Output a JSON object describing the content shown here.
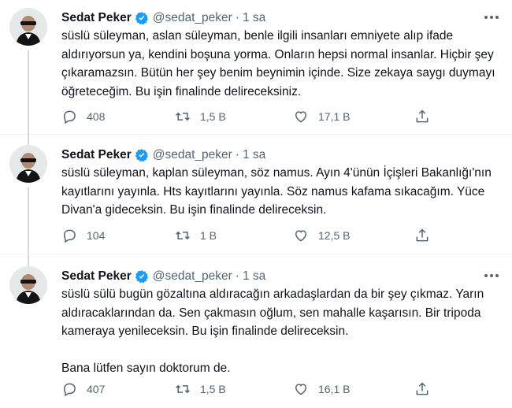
{
  "tweets": [
    {
      "name": "Sedat Peker",
      "handle": "@sedat_peker",
      "separator": "·",
      "time": "1 sa",
      "paragraphs": [
        "süslü süleyman, aslan süleyman, benle ilgili insanları emniyete alıp ifade aldırıyorsun ya, kendini boşuna yorma. Onların hepsi normal insanlar. Hiçbir şey çıkaramazsın. Bütün her şey benim beynimin içinde. Size zekaya saygı duymayı öğreteceğim. Bu işin finalinde delireceksiniz."
      ],
      "replies": "408",
      "retweets": "1,5 B",
      "likes": "17,1 B"
    },
    {
      "name": "Sedat Peker",
      "handle": "@sedat_peker",
      "separator": "·",
      "time": "1 sa",
      "paragraphs": [
        "süslü süleyman, kaplan süleyman, söz namus. Ayın 4'ünün İçişleri Bakanlığı'nın kayıtlarını yayınla. Hts kayıtlarını yayınla. Söz namus kafama sıkacağım. Yüce Divan'a gideceksin. Bu işin finalinde delireceksin."
      ],
      "replies": "104",
      "retweets": "1 B",
      "likes": "12,5 B"
    },
    {
      "name": "Sedat Peker",
      "handle": "@sedat_peker",
      "separator": "·",
      "time": "1 sa",
      "paragraphs": [
        "süslü sülü bugün gözaltına aldıracağın arkadaşlardan da bir şey çıkmaz. Yarın aldıracaklarından da. Sen çakmasın oğlum, sen mahalle kaşarısın. Bir tripoda kameraya yenileceksin. Bu işin finalinde delireceksin.",
        "Bana lütfen sayın doktorum de."
      ],
      "replies": "407",
      "retweets": "1,5 B",
      "likes": "16,1 B"
    }
  ],
  "icons": {
    "reply": "reply-icon",
    "retweet": "retweet-icon",
    "like": "heart-icon",
    "share": "share-icon",
    "verified": "verified-badge-icon",
    "more": "more-icon"
  },
  "colors": {
    "text": "#0f1419",
    "secondary": "#536471",
    "verified": "#1d9bf0",
    "thread_line": "#cfd9de"
  }
}
